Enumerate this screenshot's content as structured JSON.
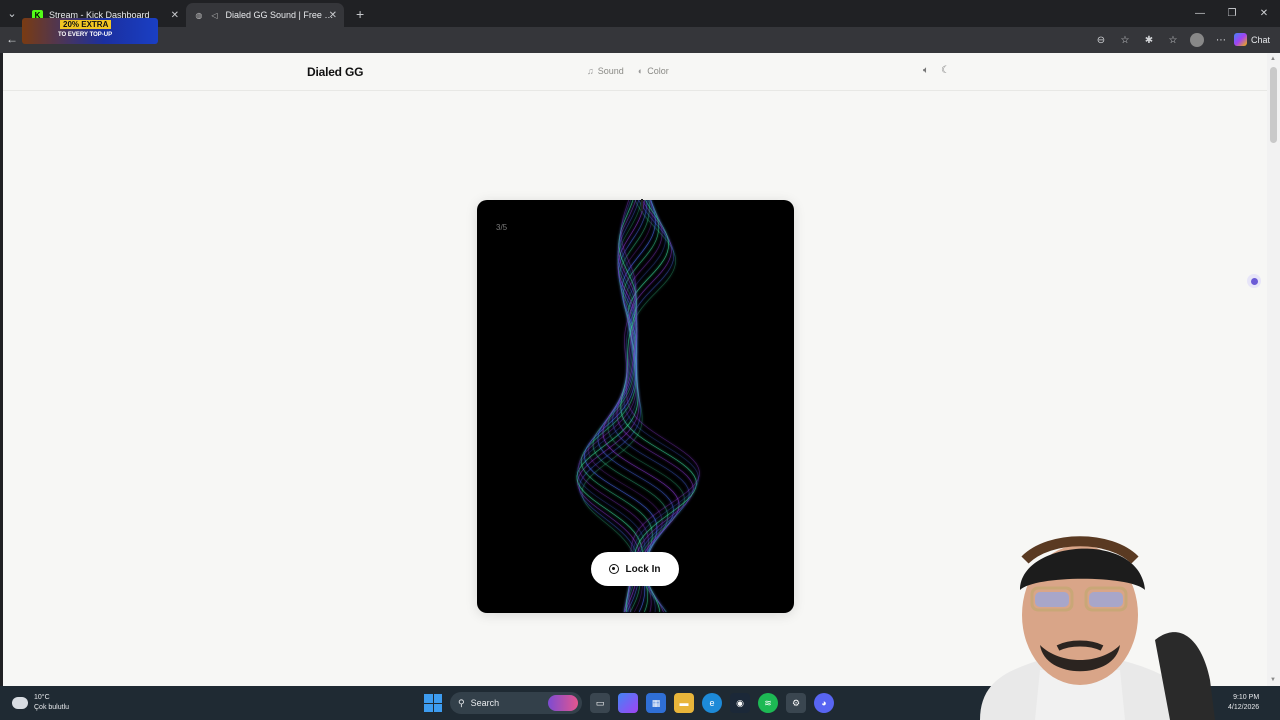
{
  "browser": {
    "tabs": [
      {
        "title": "Stream - Kick Dashboard",
        "favicon": "kick-icon"
      },
      {
        "title": "Dialed GG Sound | Free Sound",
        "favicon": "globe-icon"
      }
    ],
    "promo": {
      "line1": "20% EXTRA",
      "line2": "TO EVERY TOP-UP"
    },
    "chat_label": "Chat"
  },
  "site": {
    "brand": "Dialed GG",
    "nav": [
      {
        "label": "Sound",
        "icon": "music-note-icon"
      },
      {
        "label": "Color",
        "icon": "palette-icon"
      }
    ],
    "header_icons": [
      "volume-icon",
      "moon-icon"
    ]
  },
  "card": {
    "step": "3/5",
    "button_label": "Lock In",
    "accent_colors": [
      "#3de0a0",
      "#4a6cf0",
      "#8a3ad6"
    ]
  },
  "taskbar": {
    "weather_temp": "10°C",
    "weather_desc": "Çok bulutlu",
    "search_label": "Search",
    "time": "9:10 PM",
    "date": "4/12/2026"
  }
}
